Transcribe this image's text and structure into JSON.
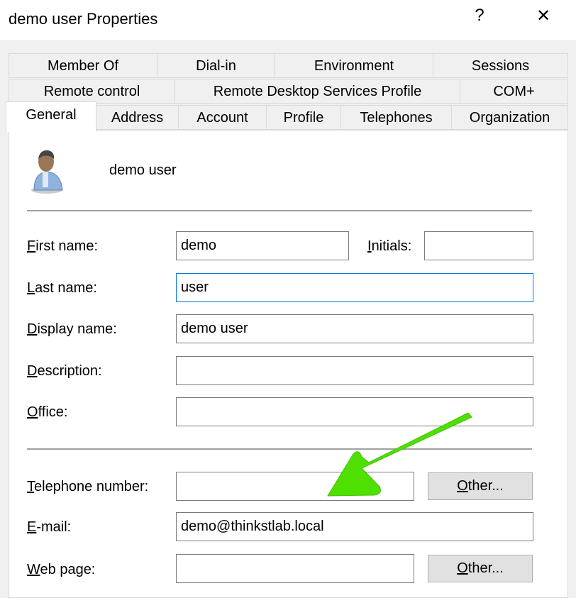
{
  "window": {
    "title": "demo user Properties",
    "help": "?",
    "close": "✕"
  },
  "tabs": {
    "row1": [
      "Member Of",
      "Dial-in",
      "Environment",
      "Sessions"
    ],
    "row2": [
      "Remote control",
      "Remote Desktop Services Profile",
      "COM+"
    ],
    "row3": [
      "General",
      "Address",
      "Account",
      "Profile",
      "Telephones",
      "Organization"
    ],
    "active": "General"
  },
  "general": {
    "user_display": "demo user",
    "icon": "user-icon",
    "fields": {
      "first_name": {
        "label": "First name:",
        "value": "demo"
      },
      "initials": {
        "label": "Initials:",
        "value": ""
      },
      "last_name": {
        "label": "Last name:",
        "value": "user"
      },
      "display_name": {
        "label": "Display name:",
        "value": "demo user"
      },
      "description": {
        "label": "Description:",
        "value": ""
      },
      "office": {
        "label": "Office:",
        "value": ""
      },
      "telephone": {
        "label": "Telephone number:",
        "value": ""
      },
      "email": {
        "label": "E-mail:",
        "value": "demo@thinkstlab.local"
      },
      "web_page": {
        "label": "Web page:",
        "value": ""
      }
    },
    "other_button": "Other..."
  },
  "annotation": {
    "arrow_color": "#4fe000"
  }
}
